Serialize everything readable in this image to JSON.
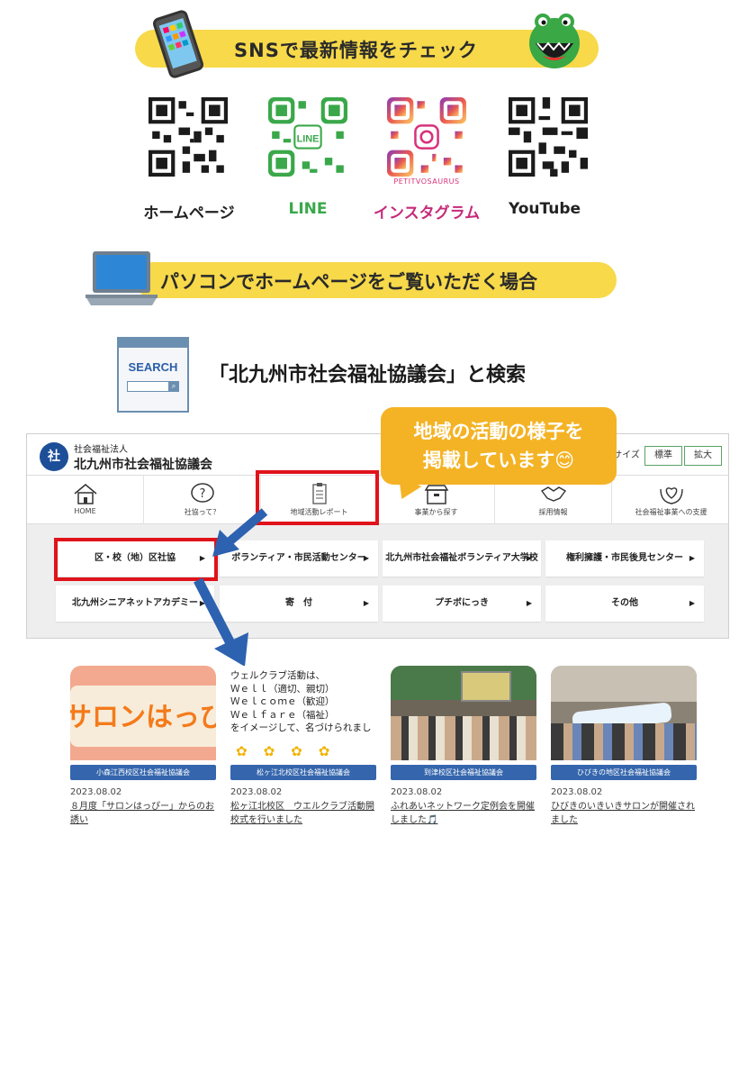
{
  "sns_banner": {
    "title": "SNSで最新情報をチェック"
  },
  "qr_codes": [
    {
      "label": "ホームページ",
      "color": "#1b1b1b"
    },
    {
      "label": "LINE",
      "color": "#3aa84a",
      "inner_text": "LINE"
    },
    {
      "label": "インスタグラム",
      "color": "#c62a7a",
      "inner_text": "PETITVOSAURUS"
    },
    {
      "label": "YouTube",
      "color": "#1b1b1b"
    }
  ],
  "pc_banner": {
    "title": "パソコンでホームページをご覧いただく場合"
  },
  "search": {
    "window_label": "SEARCH",
    "instruction": "「北九州市社会福祉協議会」と検索"
  },
  "callout": {
    "line1": "地域の活動の様子を",
    "line2": "掲載しています😊"
  },
  "website": {
    "org_type": "社会福祉法人",
    "org_name": "北九州市社会福祉協議会",
    "logo_text": "社",
    "font_sizes": [
      "字サイズ",
      "標準",
      "拡大"
    ],
    "nav": [
      {
        "label": "HOME",
        "icon": "home-icon"
      },
      {
        "label": "社協って？",
        "icon": "question-icon"
      },
      {
        "label": "地域活動レポート",
        "icon": "clipboard-icon"
      },
      {
        "label": "事業から探す",
        "icon": "box-icon"
      },
      {
        "label": "採用情報",
        "icon": "handshake-icon"
      },
      {
        "label": "社会福祉事業への支援",
        "icon": "heart-hands-icon"
      }
    ],
    "subnav": [
      "区・校（地）区社協",
      "ボランティア・市民活動センター",
      "北九州市社会福祉ボランティア大学校",
      "権利擁護・市民後見センター",
      "北九州シニアネットアカデミー",
      "寄　付",
      "プチボにっき",
      "その他"
    ]
  },
  "cards": [
    {
      "tag": "小森江西校区社会福祉協議会",
      "date": "2023.08.02",
      "title": "８月度「サロンはっぴー」からのお誘い",
      "img_text": "サロンはっぴー"
    },
    {
      "tag": "松ヶ江北校区社会福祉協議会",
      "date": "2023.08.02",
      "title": "松ヶ江北校区　ウエルクラブ活動開校式を行いました",
      "img_lines": [
        "ウェルクラブ活動は、",
        "Ｗｅｌｌ（適切、親切）",
        "Ｗｅｌｃｏｍｅ（歓迎）",
        "Ｗｅｌｆａｒｅ（福祉）",
        "をイメージして、名づけられまし"
      ]
    },
    {
      "tag": "到津校区社会福祉協議会",
      "date": "2023.08.02",
      "title": "ふれあいネットワーク定例会を開催しました🎵"
    },
    {
      "tag": "ひびきの地区社会福祉協議会",
      "date": "2023.08.02",
      "title": "ひびきのいきいきサロンが開催されました"
    }
  ],
  "colors": {
    "banner": "#f7d94a",
    "callout": "#f4b325",
    "highlight": "#e0131b",
    "arrow": "#2d62b0",
    "tag": "#3566ad"
  }
}
